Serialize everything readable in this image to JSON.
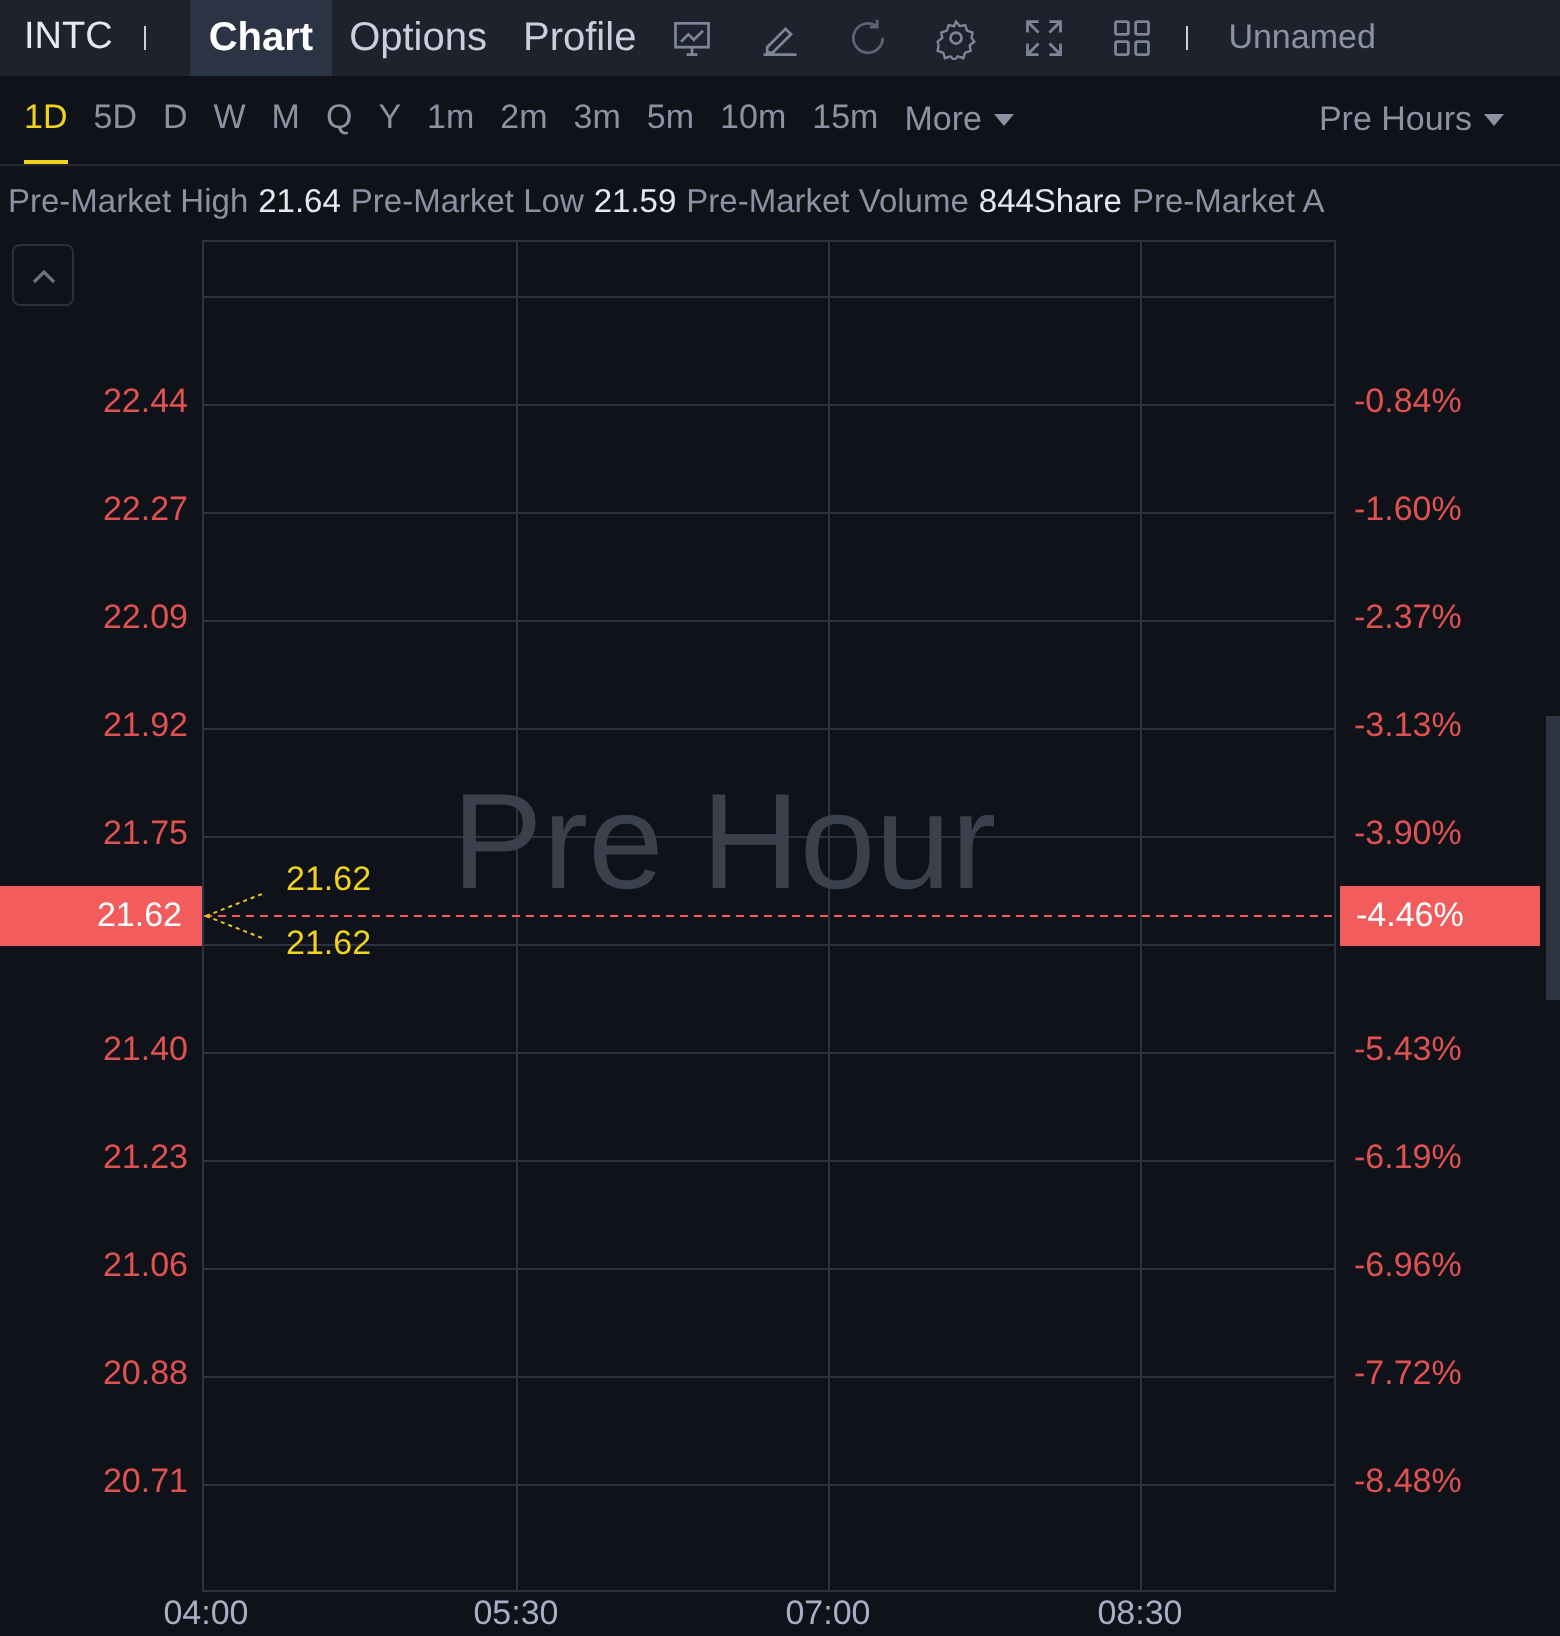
{
  "header": {
    "symbol": "INTC",
    "tabs": [
      {
        "label": "Chart",
        "selected": true
      },
      {
        "label": "Options",
        "selected": false
      },
      {
        "label": "Profile",
        "selected": false
      }
    ],
    "layout_name": "Unnamed"
  },
  "periods": [
    {
      "label": "1D",
      "selected": true
    },
    {
      "label": "5D",
      "selected": false
    },
    {
      "label": "D",
      "selected": false
    },
    {
      "label": "W",
      "selected": false
    },
    {
      "label": "M",
      "selected": false
    },
    {
      "label": "Q",
      "selected": false
    },
    {
      "label": "Y",
      "selected": false
    },
    {
      "label": "1m",
      "selected": false
    },
    {
      "label": "2m",
      "selected": false
    },
    {
      "label": "3m",
      "selected": false
    },
    {
      "label": "5m",
      "selected": false
    },
    {
      "label": "10m",
      "selected": false
    },
    {
      "label": "15m",
      "selected": false
    }
  ],
  "more_label": "More",
  "session": "Pre Hours",
  "stats": [
    {
      "label": "Pre-Market High",
      "value": "21.64"
    },
    {
      "label": "Pre-Market Low",
      "value": "21.59"
    },
    {
      "label": "Pre-Market Volume",
      "value": "844Share"
    },
    {
      "label": "Pre-Market A"
    }
  ],
  "chart": {
    "watermark": "Pre Hour",
    "price_axis": [
      "22.44",
      "22.27",
      "22.09",
      "21.92",
      "21.75",
      "21.40",
      "21.23",
      "21.06",
      "20.88",
      "20.71"
    ],
    "percent_axis": [
      "-0.84%",
      "-1.60%",
      "-2.37%",
      "-3.13%",
      "-3.90%",
      "-5.43%",
      "-6.19%",
      "-6.96%",
      "-7.72%",
      "-8.48%"
    ],
    "time_axis": [
      "04:00",
      "05:30",
      "07:00",
      "08:30"
    ],
    "last_price": "21.62",
    "last_change": "-4.46%",
    "callouts": [
      "21.62",
      "21.62"
    ]
  }
}
